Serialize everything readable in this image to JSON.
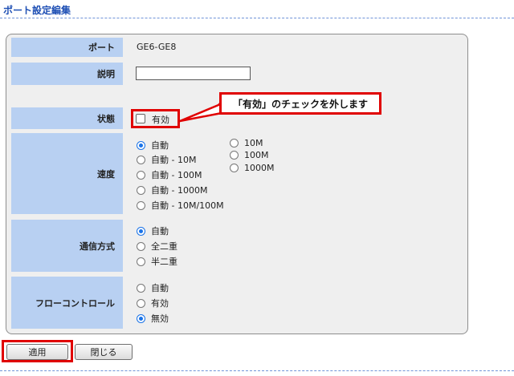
{
  "header": {
    "title": "ポート設定編集"
  },
  "form": {
    "port": {
      "label": "ポート",
      "value": "GE6-GE8"
    },
    "description": {
      "label": "説明",
      "value": ""
    },
    "status": {
      "label": "状態",
      "checkbox_label": "有効",
      "checked": false
    },
    "speed": {
      "label": "速度",
      "options_col1": [
        "自動",
        "自動 - 10M",
        "自動 - 100M",
        "自動 - 1000M",
        "自動 - 10M/100M"
      ],
      "options_col2": [
        "10M",
        "100M",
        "1000M"
      ],
      "selected": "自動"
    },
    "duplex": {
      "label": "通信方式",
      "options": [
        "自動",
        "全二重",
        "半二重"
      ],
      "selected": "自動"
    },
    "flow_control": {
      "label": "フローコントロール",
      "options": [
        "自動",
        "有効",
        "無効"
      ],
      "selected": "無効"
    }
  },
  "callout": {
    "text": "「有効」のチェックを外します"
  },
  "buttons": {
    "apply": "適用",
    "close": "閉じる"
  },
  "colors": {
    "accent": "#1e4fb4",
    "label_bg": "#b8d0f2",
    "highlight": "#e00000",
    "radio_on": "#1a73e8"
  }
}
